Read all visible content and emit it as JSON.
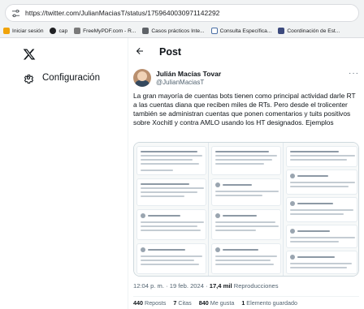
{
  "browser": {
    "url": "https://twitter.com/JulianMaciasT/status/1759640030971142292",
    "bookmarks": [
      {
        "label": "Iniciar sesión",
        "color": "#f0a30a"
      },
      {
        "label": "cap",
        "color": "#202124"
      },
      {
        "label": "FreeMyPDF.com - R...",
        "color": "#7a7a7a"
      },
      {
        "label": "Casos prácticos Inte...",
        "color": "#5f6368"
      },
      {
        "label": "Consulta Específica...",
        "color": "#4a6fa5"
      },
      {
        "label": "Coordinación de Est...",
        "color": "#3c4a7d"
      }
    ]
  },
  "sidebar": {
    "settings_label": "Configuración"
  },
  "post": {
    "header_title": "Post",
    "author_name": "Julián Macías Tovar",
    "author_handle": "@JulianMaciasT",
    "text": "La gran mayoría de cuentas bots tienen como principal actividad darle RT a las cuentas diana que reciben miles de RTs. Pero desde el trolicenter también se administran cuentas que ponen comentarios y tuits positivos sobre Xochitl y contra AMLO usando los HT designados. Ejemplos",
    "timestamp": "12:04 p. m. · 19 feb. 2024 · ",
    "views_count": "17,4 mil",
    "views_label": " Reproducciones",
    "stats": [
      {
        "count": "440",
        "label": " Reposts"
      },
      {
        "count": "7",
        "label": " Citas"
      },
      {
        "count": "840",
        "label": " Me gusta"
      },
      {
        "count": "1",
        "label": " Elemento guardado"
      }
    ]
  },
  "colors": {
    "text_primary": "#0f1419",
    "text_secondary": "#536471",
    "border": "#cfd9de"
  }
}
